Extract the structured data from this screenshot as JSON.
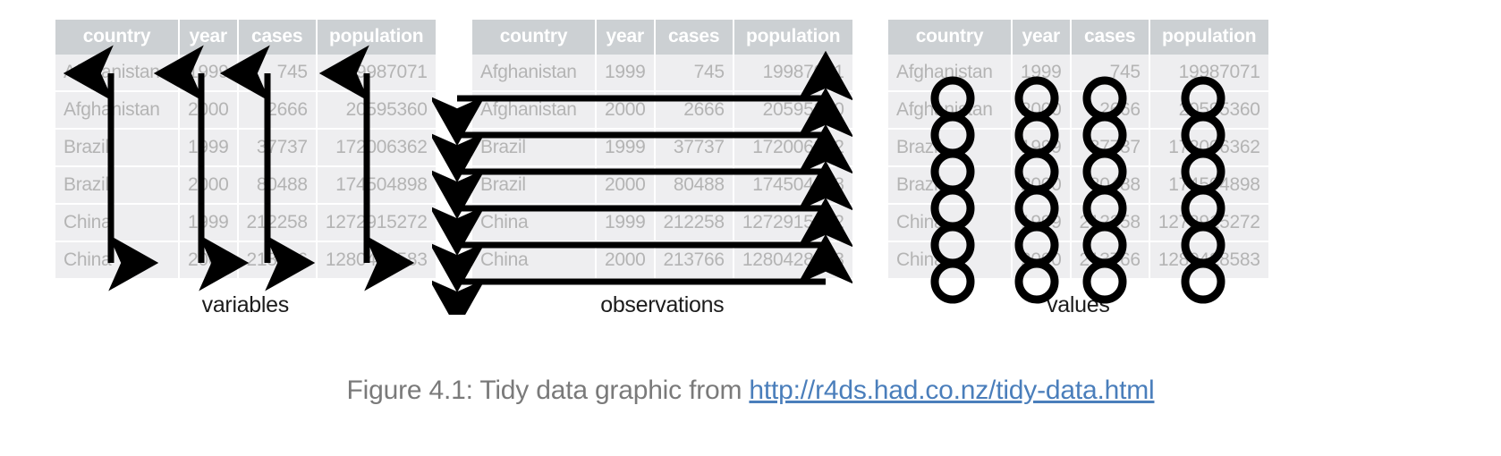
{
  "figure": {
    "caption_prefix": "Figure 4.1: Tidy data graphic from",
    "caption_link": "http://r4ds.had.co.nz/tidy-data.html",
    "link_color": "#4a7ebb",
    "caption_color": "#7a7a7a"
  },
  "table": {
    "columns": [
      "country",
      "year",
      "cases",
      "population"
    ],
    "header_bg": "#ccd0d3",
    "header_color": "#ffffff",
    "cell_bg": "#eeeef0",
    "cell_color": "#b4b4b4",
    "rows": [
      {
        "country": "Afghanistan",
        "year": "1999",
        "cases": "745",
        "population": "19987071"
      },
      {
        "country": "Afghanistan",
        "year": "2000",
        "cases": "2666",
        "population": "20595360"
      },
      {
        "country": "Brazil",
        "year": "1999",
        "cases": "37737",
        "population": "172006362"
      },
      {
        "country": "Brazil",
        "year": "2000",
        "cases": "80488",
        "population": "174504898"
      },
      {
        "country": "China",
        "year": "1999",
        "cases": "212258",
        "population": "1272915272"
      },
      {
        "country": "China",
        "year": "2000",
        "cases": "213766",
        "population": "1280428583"
      }
    ]
  },
  "panels": [
    {
      "id": "variables",
      "label": "variables",
      "annotation": "vertical-double-arrows"
    },
    {
      "id": "observations",
      "label": "observations",
      "annotation": "horizontal-double-arrows"
    },
    {
      "id": "values",
      "label": "values",
      "annotation": "circles"
    }
  ]
}
